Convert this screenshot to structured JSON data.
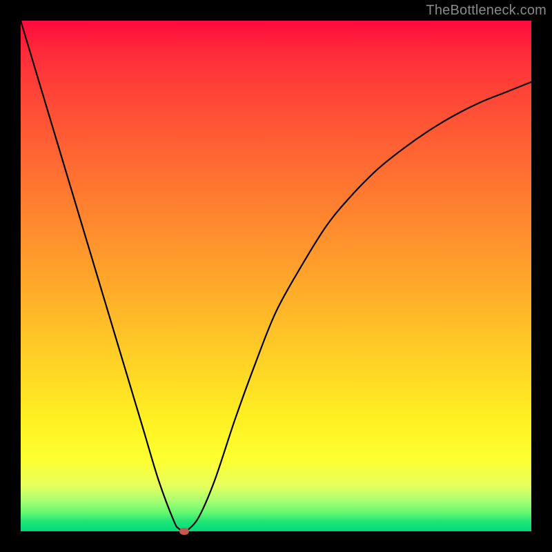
{
  "watermark": "TheBottleneck.com",
  "chart_data": {
    "type": "line",
    "title": "",
    "xlabel": "",
    "ylabel": "",
    "xlim": [
      0,
      100
    ],
    "ylim": [
      0,
      100
    ],
    "grid": false,
    "legend": null,
    "background_gradient": {
      "orientation": "vertical",
      "stops": [
        {
          "pos": 0,
          "color": "#ff0a3c"
        },
        {
          "pos": 0.5,
          "color": "#ffac2a"
        },
        {
          "pos": 0.85,
          "color": "#fdff30"
        },
        {
          "pos": 1.0,
          "color": "#00da7a"
        }
      ]
    },
    "series": [
      {
        "name": "curve",
        "color": "#000000",
        "x": [
          0,
          3,
          6,
          9,
          12,
          15,
          18,
          21,
          24,
          27,
          30,
          31,
          32,
          33,
          35,
          38,
          42,
          46,
          50,
          55,
          60,
          65,
          70,
          75,
          80,
          85,
          90,
          95,
          100
        ],
        "y": [
          100,
          90,
          80,
          70,
          60,
          50,
          40,
          30,
          20,
          10,
          2,
          0.5,
          0,
          0.5,
          3,
          10,
          22,
          33,
          43,
          52,
          60,
          66,
          71,
          75,
          78.5,
          81.5,
          84,
          86,
          88
        ]
      }
    ],
    "marker": {
      "name": "bottleneck-point",
      "x": 32,
      "y": 0,
      "color": "#c25a4f",
      "shape": "rounded-rect"
    }
  }
}
